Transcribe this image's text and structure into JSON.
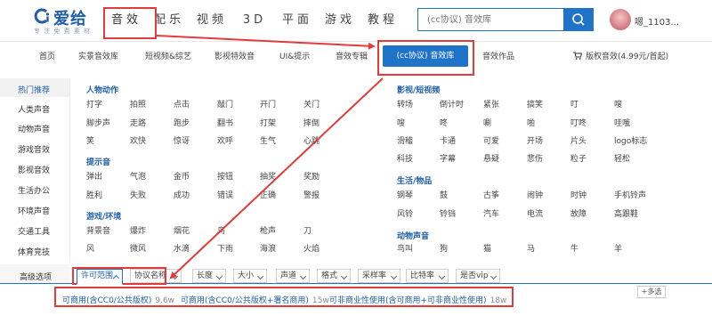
{
  "brand": {
    "name": "爱给",
    "tagline": "专 注 免 费 素 材"
  },
  "main_nav": [
    "音效",
    "配乐",
    "视频",
    "3D",
    "平面",
    "游戏",
    "教程"
  ],
  "search": {
    "placeholder": "(cc协议) 音效库"
  },
  "user": {
    "name": "嗯_1103..."
  },
  "sub_nav": {
    "items": [
      "首页",
      "实景音效库",
      "短视频&综艺",
      "影视特效音",
      "UI&提示",
      "音效专辑"
    ],
    "active": "(cc协议) 音效库",
    "works": "音效作品",
    "license": "版权音效(4.99元/首起)"
  },
  "categories": [
    "热门推荐",
    "人类声音",
    "动物声音",
    "游戏音效",
    "影视音效",
    "生活办公",
    "环境声音",
    "交通工具",
    "体育竞技"
  ],
  "sections": {
    "human": {
      "title": "人物动作",
      "tags": [
        "打字",
        "拍照",
        "点击",
        "敲门",
        "开门",
        "关门",
        "脚步声",
        "走路",
        "跑步",
        "翻书",
        "打架",
        "摔倒",
        "笑",
        "欢快",
        "惊讶",
        "欢呼",
        "生气",
        "心跳"
      ]
    },
    "prompt": {
      "title": "提示音",
      "tags": [
        "弹出",
        "气泡",
        "金币",
        "按钮",
        "抽奖",
        "奖励",
        "胜利",
        "失败",
        "成功",
        "错误",
        "正确",
        "警报"
      ]
    },
    "game": {
      "title": "游戏/环境",
      "tags": [
        "背景音",
        "爆炸",
        "烟花",
        "鸟",
        "枪声",
        "刀",
        "风",
        "微风",
        "水滴",
        "下雨",
        "海浪",
        "火焰"
      ]
    },
    "film": {
      "title": "影视/短视频",
      "tags": [
        "转场",
        "倒计时",
        "紧张",
        "搞笑",
        "叮",
        "嗖",
        "嗖",
        "咚",
        "唰",
        "啪",
        "叮咚",
        "哇哦",
        "滑稽",
        "卡通",
        "可爱",
        "开场",
        "片头",
        "logo标志",
        "科技",
        "字幕",
        "悬疑",
        "悲伤",
        "粒子",
        "轻松"
      ]
    },
    "life": {
      "title": "生活/物品",
      "tags": [
        "钢琴",
        "鼓",
        "古筝",
        "闹钟",
        "时钟",
        "手机铃声",
        "风铃",
        "铃铛",
        "汽车",
        "电流",
        "故障",
        "高跟鞋"
      ]
    },
    "animal": {
      "title": "动物声音",
      "tags": [
        "鸟叫",
        "狗",
        "猫",
        "马",
        "牛",
        "羊"
      ]
    }
  },
  "filters": {
    "label": "高级选项",
    "buttons": [
      "许可范围",
      "协议名称",
      "长度",
      "大小",
      "声道",
      "格式",
      "采样率",
      "比特率",
      "是否vip"
    ],
    "options": [
      {
        "label": "可商用(含CC0/公共版权)",
        "count": "9.6w"
      },
      {
        "label": "可商用(含CC0/公共版权+署名商用)",
        "count": "15w"
      },
      {
        "label": "可非商业性使用(含可商用+可非商业性使用)",
        "count": "18w"
      }
    ],
    "multi": "+多选"
  },
  "colors": {
    "accent": "#1f73c9",
    "highlight": "#e33b3b"
  }
}
